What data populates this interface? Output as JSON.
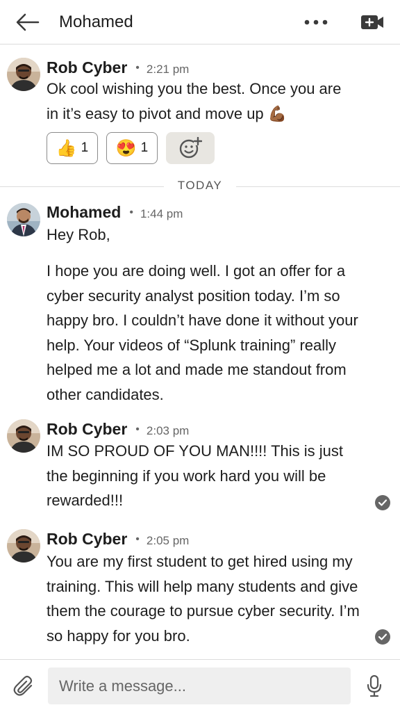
{
  "header": {
    "title": "Mohamed"
  },
  "day_divider": "TODAY",
  "messages": [
    {
      "sender": "Rob Cyber",
      "time": "2:21 pm",
      "text": "Ok cool wishing you the best. Once you are in it’s easy to pivot and move up 💪🏾",
      "reactions": [
        {
          "emoji": "👍",
          "count": "1"
        },
        {
          "emoji": "😍",
          "count": "1"
        }
      ]
    },
    {
      "sender": "Mohamed",
      "time": "1:44 pm",
      "text_lines": [
        "Hey Rob,",
        "",
        "I hope you are doing well. I got an offer for a cyber security analyst position today. I’m so happy bro. I couldn’t have done it without your help. Your videos of “Splunk training” really helped me a lot and made me standout from other candidates."
      ]
    },
    {
      "sender": "Rob Cyber",
      "time": "2:03 pm",
      "text": "IM SO PROUD OF YOU MAN!!!! This is just the beginning if you work hard you will be rewarded!!!"
    },
    {
      "sender": "Rob Cyber",
      "time": "2:05 pm",
      "text": "You are my first student to get hired using my training. This will help many students and give them the courage to pursue cyber security. I’m so happy for you bro."
    }
  ],
  "composer": {
    "placeholder": "Write a message..."
  }
}
